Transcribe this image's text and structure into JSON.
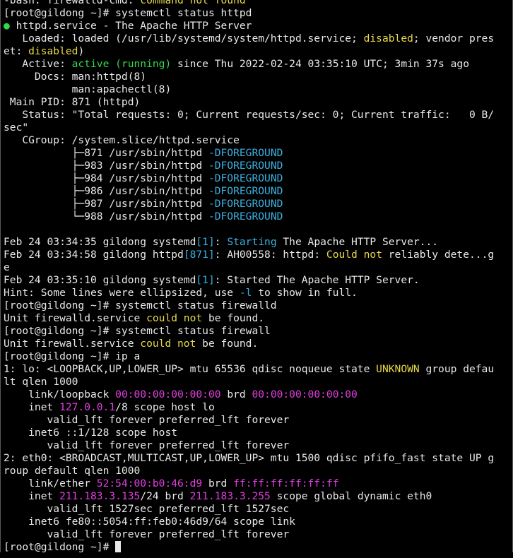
{
  "colors": {
    "default": "#e8e8e8",
    "green": "#30d94a",
    "yellow": "#e6d84a",
    "cyan": "#3bb0e0",
    "magenta": "#e23ee2"
  },
  "terminal": {
    "lines": [
      [
        [
          "-bash: firewalld-cmd: ",
          ""
        ],
        [
          "command not found",
          "yellow"
        ]
      ],
      [
        [
          "[root@gildong ~]# systemctl status httpd",
          ""
        ]
      ],
      [
        [
          "●",
          "green"
        ],
        [
          " httpd.service - The Apache HTTP Server",
          ""
        ]
      ],
      [
        [
          "   Loaded: loaded (/usr/lib/systemd/system/httpd.service; ",
          ""
        ],
        [
          "disabled",
          "yellow"
        ],
        [
          "; vendor pres",
          ""
        ]
      ],
      [
        [
          "et: ",
          ""
        ],
        [
          "disabled",
          "yellow"
        ],
        [
          ")",
          ""
        ]
      ],
      [
        [
          "   Active: ",
          ""
        ],
        [
          "active (running)",
          "green"
        ],
        [
          " since Thu 2022-02-24 03:35:10 UTC; 3min 37s ago",
          ""
        ]
      ],
      [
        [
          "     Docs: man:httpd(8)",
          ""
        ]
      ],
      [
        [
          "           man:apachectl(8)",
          ""
        ]
      ],
      [
        [
          " Main PID: 871 (httpd)",
          ""
        ]
      ],
      [
        [
          "   Status: \"Total requests: 0; Current requests/sec: 0; Current traffic:   0 B/",
          ""
        ]
      ],
      [
        [
          "sec\"",
          ""
        ]
      ],
      [
        [
          "   CGroup: /system.slice/httpd.service",
          ""
        ]
      ],
      [
        [
          "           ├─871 /usr/sbin/httpd ",
          ""
        ],
        [
          "-DFOREGROUND",
          "cyan"
        ]
      ],
      [
        [
          "           ├─983 /usr/sbin/httpd ",
          ""
        ],
        [
          "-DFOREGROUND",
          "cyan"
        ]
      ],
      [
        [
          "           ├─984 /usr/sbin/httpd ",
          ""
        ],
        [
          "-DFOREGROUND",
          "cyan"
        ]
      ],
      [
        [
          "           ├─986 /usr/sbin/httpd ",
          ""
        ],
        [
          "-DFOREGROUND",
          "cyan"
        ]
      ],
      [
        [
          "           ├─987 /usr/sbin/httpd ",
          ""
        ],
        [
          "-DFOREGROUND",
          "cyan"
        ]
      ],
      [
        [
          "           └─988 /usr/sbin/httpd ",
          ""
        ],
        [
          "-DFOREGROUND",
          "cyan"
        ]
      ],
      [
        [
          "",
          ""
        ]
      ],
      [
        [
          "Feb 24 03:34:35 gildong systemd",
          ""
        ],
        [
          "[1]",
          "cyan"
        ],
        [
          ": ",
          ""
        ],
        [
          "Starting",
          "cyan"
        ],
        [
          " The Apache HTTP Server...",
          ""
        ]
      ],
      [
        [
          "Feb 24 03:34:58 gildong httpd",
          ""
        ],
        [
          "[871]",
          "cyan"
        ],
        [
          ": AH00558: httpd: ",
          ""
        ],
        [
          "Could not",
          "yellow"
        ],
        [
          " reliably dete...g",
          ""
        ]
      ],
      [
        [
          "e",
          ""
        ]
      ],
      [
        [
          "Feb 24 03:35:10 gildong systemd",
          ""
        ],
        [
          "[1]",
          "cyan"
        ],
        [
          ": Started The Apache HTTP Server.",
          ""
        ]
      ],
      [
        [
          "Hint: Some lines were ellipsized, use ",
          ""
        ],
        [
          "-l",
          "cyan"
        ],
        [
          " to show in full.",
          ""
        ]
      ],
      [
        [
          "[root@gildong ~]# systemctl status firewalld",
          ""
        ]
      ],
      [
        [
          "Unit firewalld.service ",
          ""
        ],
        [
          "could not",
          "yellow"
        ],
        [
          " be found.",
          ""
        ]
      ],
      [
        [
          "[root@gildong ~]# systemctl status firewall",
          ""
        ]
      ],
      [
        [
          "Unit firewall.service ",
          ""
        ],
        [
          "could not",
          "yellow"
        ],
        [
          " be found.",
          ""
        ]
      ],
      [
        [
          "[root@gildong ~]# ip a",
          ""
        ]
      ],
      [
        [
          "1: lo: <LOOPBACK,UP,LOWER_UP> mtu 65536 qdisc noqueue state ",
          ""
        ],
        [
          "UNKNOWN",
          "yellow"
        ],
        [
          " group defau",
          ""
        ]
      ],
      [
        [
          "lt qlen 1000",
          ""
        ]
      ],
      [
        [
          "    link/loopback ",
          ""
        ],
        [
          "00:00:00:00:00:00",
          "magenta"
        ],
        [
          " brd ",
          ""
        ],
        [
          "00:00:00:00:00:00",
          "magenta"
        ]
      ],
      [
        [
          "    inet ",
          ""
        ],
        [
          "127.0.0.1",
          "magenta"
        ],
        [
          "/8 scope host lo",
          ""
        ]
      ],
      [
        [
          "       valid_lft forever preferred_lft forever",
          ""
        ]
      ],
      [
        [
          "    inet6 ::1/128 scope host",
          ""
        ]
      ],
      [
        [
          "       valid_lft forever preferred_lft forever",
          ""
        ]
      ],
      [
        [
          "2: eth0: <BROADCAST,MULTICAST,UP,LOWER_UP> mtu 1500 qdisc pfifo_fast state UP g",
          ""
        ]
      ],
      [
        [
          "roup default qlen 1000",
          ""
        ]
      ],
      [
        [
          "    link/ether ",
          ""
        ],
        [
          "52:54:00:b0:46:d9",
          "magenta"
        ],
        [
          " brd ",
          ""
        ],
        [
          "ff:ff:ff:ff:ff:ff",
          "magenta"
        ]
      ],
      [
        [
          "    inet ",
          ""
        ],
        [
          "211.183.3.135",
          "magenta"
        ],
        [
          "/24 brd ",
          ""
        ],
        [
          "211.183.3.255",
          "magenta"
        ],
        [
          " scope global dynamic eth0",
          ""
        ]
      ],
      [
        [
          "       valid_lft 1527sec preferred_lft 1527sec",
          ""
        ]
      ],
      [
        [
          "    inet6 fe80::5054:ff:feb0:46d9/64 scope link",
          ""
        ]
      ],
      [
        [
          "       valid_lft forever preferred_lft forever",
          ""
        ]
      ],
      [
        [
          "[root@gildong ~]# ",
          ""
        ]
      ]
    ]
  }
}
